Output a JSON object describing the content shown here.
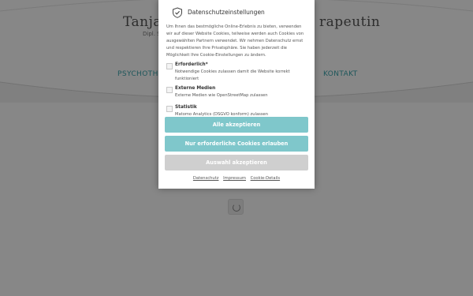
{
  "site": {
    "title_left": "Tanja Pa",
    "title_right": "rapeutin",
    "subtitle": "Dipl. S",
    "nav_left": "PSYCHOTHE",
    "nav_right": "KONTAKT"
  },
  "dialog": {
    "title": "Datenschutzeinstellungen",
    "text": "Um Ihnen das bestmögliche Online-Erlebnis zu bieten, verwenden wir auf dieser Website Cookies, teilweise werden auch Cookies von ausgewählten Partnern verwendet. Wir nehmen Datenschutz ernst und respektieren Ihre Privatsphäre. Sie haben jederzeit die Möglichkeit Ihre Cookie-Einstellungen zu ändern.",
    "options": [
      {
        "label": "Erforderlich*",
        "desc": "Notwendige Cookies zulassen damit die Website korrekt funktioniert"
      },
      {
        "label": "Externe Medien",
        "desc": "Externe Medien wie OpenStreetMap zulassen"
      },
      {
        "label": "Statistik",
        "desc": "Matomo Analytics (DSGVO konform) zulassen"
      }
    ],
    "btn_accept_all": "Alle akzeptieren",
    "btn_required_only": "Nur erforderliche Cookies erlauben",
    "btn_accept_selection": "Auswahl akzeptieren",
    "links": [
      "Datenschutz",
      "Impressum",
      "Cookie-Details"
    ]
  },
  "colors": {
    "accent": "#7fc7cb",
    "nav_text": "#3aa5ad",
    "disabled_button": "#cfcfcf",
    "overlay": "rgba(0,0,0,0.47)"
  }
}
